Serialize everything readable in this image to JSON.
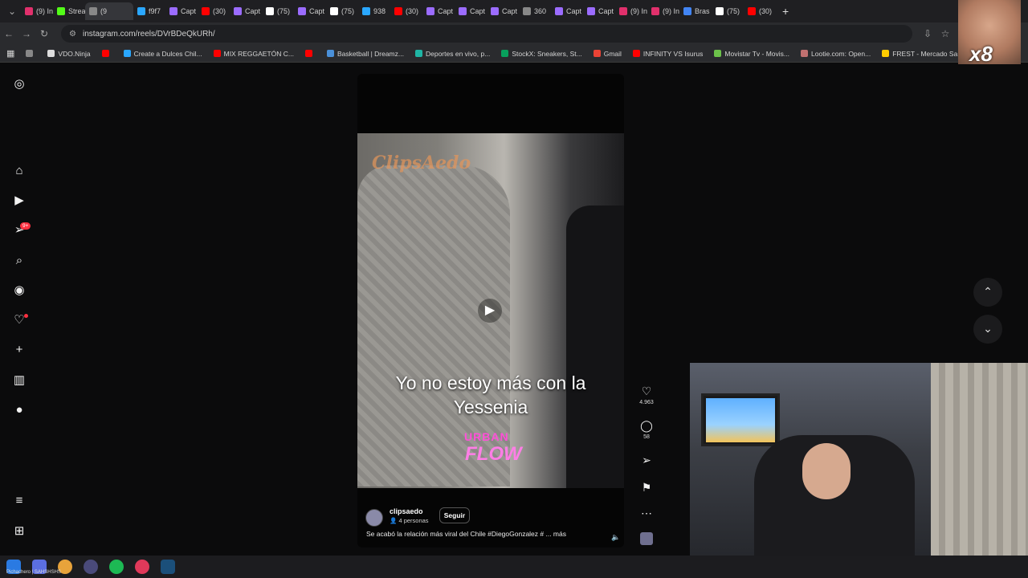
{
  "browser": {
    "tabs": [
      {
        "label": "(9) In",
        "color": "#e1306c"
      },
      {
        "label": "Strea",
        "color": "#53fc18"
      },
      {
        "label": "(9",
        "color": "#888888",
        "active": true
      },
      {
        "label": "f9f7",
        "color": "#2aa7ff"
      },
      {
        "label": "Capt",
        "color": "#9b6cff"
      },
      {
        "label": "(30)",
        "color": "#ff0000"
      },
      {
        "label": "Capt",
        "color": "#9b6cff"
      },
      {
        "label": "(75)",
        "color": "#ffffff"
      },
      {
        "label": "Capt",
        "color": "#9b6cff"
      },
      {
        "label": "(75)",
        "color": "#ffffff"
      },
      {
        "label": "938",
        "color": "#2aa7ff"
      },
      {
        "label": "(30)",
        "color": "#ff0000"
      },
      {
        "label": "Capt",
        "color": "#9b6cff"
      },
      {
        "label": "Capt",
        "color": "#9b6cff"
      },
      {
        "label": "Capt",
        "color": "#9b6cff"
      },
      {
        "label": "360",
        "color": "#888888"
      },
      {
        "label": "Capt",
        "color": "#9b6cff"
      },
      {
        "label": "Capt",
        "color": "#9b6cff"
      },
      {
        "label": "(9) In",
        "color": "#e1306c"
      },
      {
        "label": "(9) In",
        "color": "#e1306c"
      },
      {
        "label": "Bras",
        "color": "#4285f4"
      },
      {
        "label": "(75)",
        "color": "#ffffff"
      },
      {
        "label": "(30)",
        "color": "#ff0000"
      }
    ],
    "new_tab": "+",
    "url": "instagram.com/reels/DVrBDeQkURh/",
    "bookmarks": [
      {
        "label": "",
        "color": "#888888"
      },
      {
        "label": "VDO.Ninja",
        "color": "#dddddd"
      },
      {
        "label": "",
        "color": "#ff0000"
      },
      {
        "label": "Create a Dulces Chil...",
        "color": "#2aa7ff"
      },
      {
        "label": "MIX REGGAETÓN C...",
        "color": "#ff0000"
      },
      {
        "label": "",
        "color": "#ff0000"
      },
      {
        "label": "Basketball | Dreamz...",
        "color": "#4a90d9"
      },
      {
        "label": "Deportes en vivo, p...",
        "color": "#1fb5a5"
      },
      {
        "label": "StockX: Sneakers, St...",
        "color": "#08a05c"
      },
      {
        "label": "Gmail",
        "color": "#ea4335"
      },
      {
        "label": "INFINITY VS Isurus",
        "color": "#ff0000"
      },
      {
        "label": "Movistar Tv - Movis...",
        "color": "#6cc24a"
      },
      {
        "label": "Lootie.com: Open...",
        "color": "#c07070"
      },
      {
        "label": "FREST - Mercado Sa...",
        "color": "#ffcc00"
      }
    ]
  },
  "sidebar": {
    "notification_badge": "9+"
  },
  "reel": {
    "watermark": "ClipsAedo",
    "caption_line1": "Yo no estoy más con la",
    "caption_line2": "Yessenia",
    "logo_top": "URBAN",
    "logo_bottom": "FLOW",
    "username": "clipsaedo",
    "people": "4 personas",
    "follow_label": "Seguir",
    "description": "Se acabó la relación más viral del Chile #DiegoGonzalez # ... más",
    "likes": "4.963",
    "comments": "58"
  },
  "overlay": {
    "multiplier": "x8"
  },
  "taskbar": {
    "label": "Pichachero | SAHSHSHS"
  }
}
